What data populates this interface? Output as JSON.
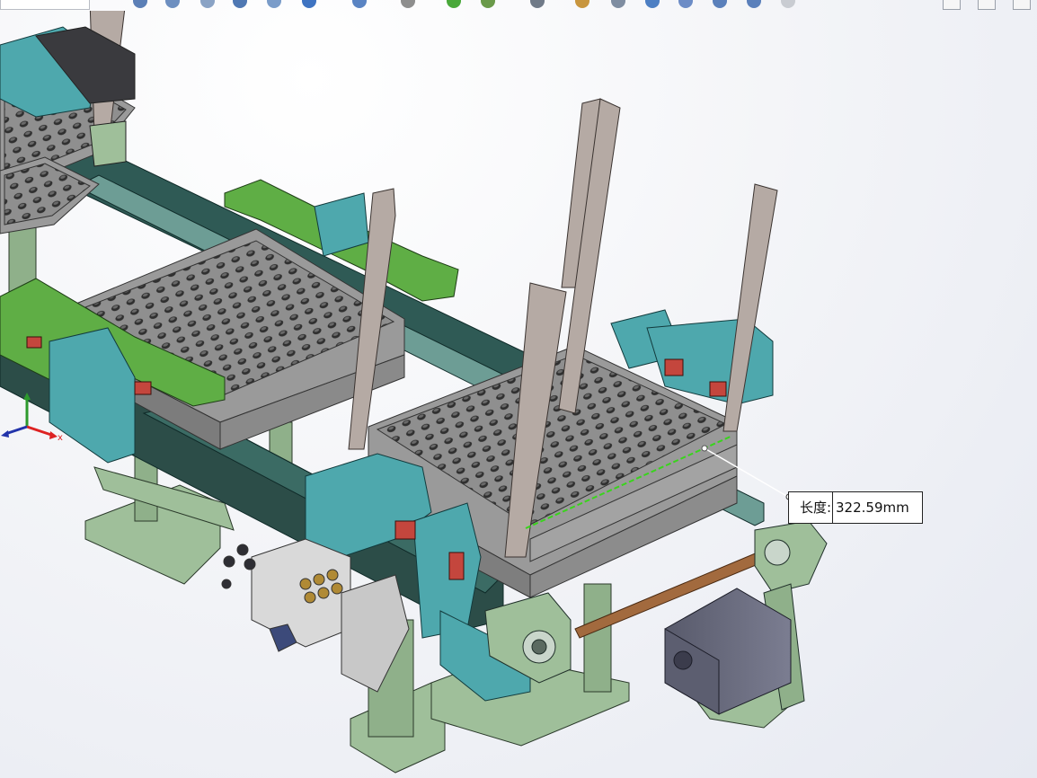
{
  "measurement": {
    "label": "长度:",
    "value": "322.59mm"
  },
  "triad": {
    "x_axis_label": "x"
  },
  "toolbar": {
    "icons": [
      "zoom-to-fit-icon",
      "zoom-to-area-icon",
      "previous-view-icon",
      "section-view-icon",
      "dynamic-annotation-icon",
      "view-orientation-icon",
      "display-style-icon",
      "hide-show-items-icon",
      "edit-appearance-icon",
      "apply-scene-icon",
      "view-settings-icon",
      "move-component-icon",
      "mate-icon",
      "rotate-icon",
      "roll-view-icon",
      "zoom-in-icon",
      "zoom-out-icon",
      "select-icon"
    ]
  },
  "colors": {
    "frame_green": "#9fbf9a",
    "bracket_teal": "#4ea8ad",
    "plate_grey": "#9a9a9a",
    "rod_grey": "#b5aaa4",
    "bright_green": "#5fae45",
    "motor_grey": "#6e6f80",
    "shaft_brown": "#a26a3e",
    "dim_line": "#39d41c"
  }
}
